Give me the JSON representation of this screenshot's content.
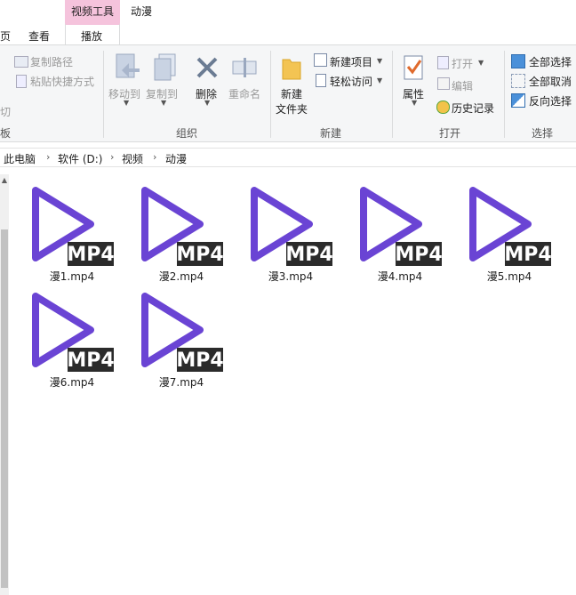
{
  "tabs": {
    "partial_left": "页",
    "view": "查看",
    "context_group": "视频工具",
    "play": "播放",
    "title": "动漫"
  },
  "ribbon": {
    "clipboard": {
      "copy_path": "复制路径",
      "paste_shortcut": "粘贴快捷方式",
      "partial_cut": "切",
      "partial_group_label": "板"
    },
    "organize": {
      "move_to": "移动到",
      "copy_to": "复制到",
      "delete": "删除",
      "rename": "重命名",
      "group_label": "组织"
    },
    "new": {
      "new_folder_line1": "新建",
      "new_folder_line2": "文件夹",
      "new_item": "新建项目",
      "easy_access": "轻松访问",
      "group_label": "新建"
    },
    "open": {
      "properties": "属性",
      "open": "打开",
      "edit": "编辑",
      "history": "历史记录",
      "group_label": "打开"
    },
    "select": {
      "select_all": "全部选择",
      "select_none": "全部取消",
      "invert": "反向选择",
      "group_label": "选择"
    }
  },
  "breadcrumb": [
    "此电脑",
    "软件 (D:)",
    "视频",
    "动漫"
  ],
  "files": [
    {
      "name": "漫1.mp4",
      "badge": "MP4"
    },
    {
      "name": "漫2.mp4",
      "badge": "MP4"
    },
    {
      "name": "漫3.mp4",
      "badge": "MP4"
    },
    {
      "name": "漫4.mp4",
      "badge": "MP4"
    },
    {
      "name": "漫5.mp4",
      "badge": "MP4"
    },
    {
      "name": "漫6.mp4",
      "badge": "MP4"
    },
    {
      "name": "漫7.mp4",
      "badge": "MP4"
    }
  ],
  "colors": {
    "play_icon": "#6a44d4",
    "badge_bg": "#2b2b2b",
    "context_tab": "#f5c3dc"
  }
}
